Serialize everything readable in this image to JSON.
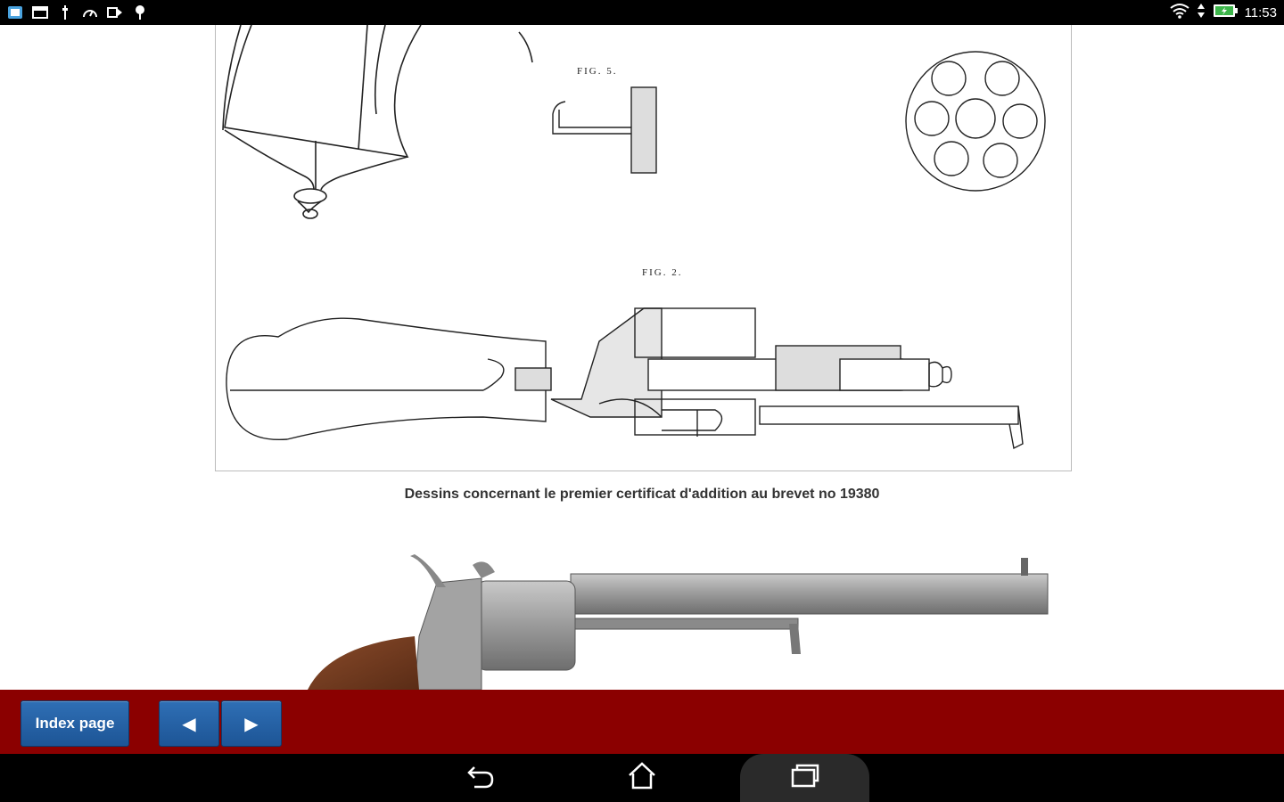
{
  "status_bar": {
    "time": "11:53",
    "left_icons": [
      "screen-icon",
      "window-icon",
      "usb-icon",
      "speed-icon",
      "play-store-icon",
      "location-icon"
    ],
    "right_icons": [
      "wifi-icon",
      "data-arrows-icon",
      "battery-icon"
    ]
  },
  "page": {
    "caption": "Dessins concernant le premier certificat d'addition au brevet no 19380",
    "figure_labels": {
      "fig5": "FIG. 5.",
      "fig2": "FIG. 2."
    }
  },
  "toolbar": {
    "index_label": "Index page",
    "prev_label": "◀",
    "next_label": "▶"
  },
  "navbar": {
    "icons": [
      "back-icon",
      "home-icon",
      "recent-apps-icon"
    ]
  },
  "colors": {
    "toolbar_bg": "#8b0000",
    "button_blue": "#1d5596",
    "status_bg": "#000000"
  }
}
